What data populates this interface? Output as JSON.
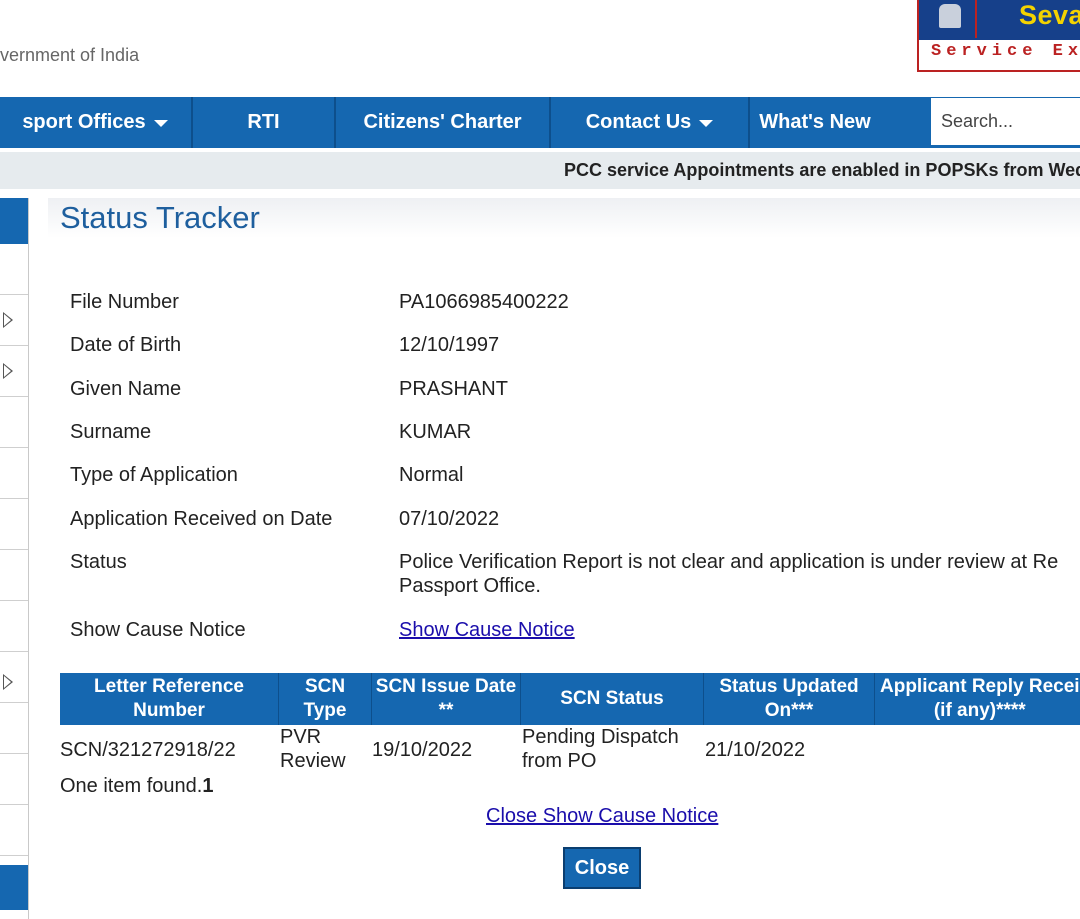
{
  "header": {
    "gov_text": "vernment of India",
    "logo": {
      "brand": "Seva",
      "tagline": "Service Exce",
      "emblem_icon": "national-emblem-icon"
    }
  },
  "nav": {
    "items": [
      {
        "label": "sport Offices",
        "has_dropdown": true
      },
      {
        "label": "RTI",
        "has_dropdown": false
      },
      {
        "label": "Citizens' Charter",
        "has_dropdown": false
      },
      {
        "label": "Contact Us",
        "has_dropdown": true
      },
      {
        "label": "What's New",
        "has_dropdown": false
      }
    ],
    "search": {
      "placeholder": "Search...",
      "value": ""
    }
  },
  "ticker": {
    "text": "PCC service Appointments are enabled in POPSKs from Wed"
  },
  "page": {
    "title": "Status Tracker",
    "fields": [
      {
        "label": "File Number",
        "value": "PA1066985400222"
      },
      {
        "label": "Date of Birth",
        "value": "12/10/1997"
      },
      {
        "label": "Given Name",
        "value": "PRASHANT"
      },
      {
        "label": "Surname",
        "value": "KUMAR"
      },
      {
        "label": "Type of Application",
        "value": "Normal"
      },
      {
        "label": "Application Received on Date",
        "value": "07/10/2022"
      },
      {
        "label": "Status",
        "value": "Police Verification Report is not clear and application is under review at Re Passport Office."
      },
      {
        "label": "Show Cause Notice",
        "value": "Show Cause Notice"
      }
    ]
  },
  "scn_table": {
    "headers": [
      "Letter Reference\nNumber",
      "SCN\nType",
      "SCN Issue Date\n**",
      "SCN Status",
      "Status Updated\nOn***",
      "Applicant Reply Recei\n(if any)****"
    ],
    "rows": [
      [
        "SCN/321272918/22",
        "PVR\nReview",
        "19/10/2022",
        "Pending Dispatch\nfrom PO",
        "21/10/2022",
        ""
      ]
    ],
    "found_text": "One item found.",
    "found_count": "1"
  },
  "actions": {
    "close_scn_link": "Close Show Cause Notice",
    "close_button": "Close"
  },
  "colors": {
    "nav_blue": "#1567b0",
    "title_blue": "#1e5f9e",
    "link": "#1a0dab",
    "logo_blue": "#16408a",
    "logo_yellow": "#f4d300",
    "logo_red": "#bb2222"
  }
}
